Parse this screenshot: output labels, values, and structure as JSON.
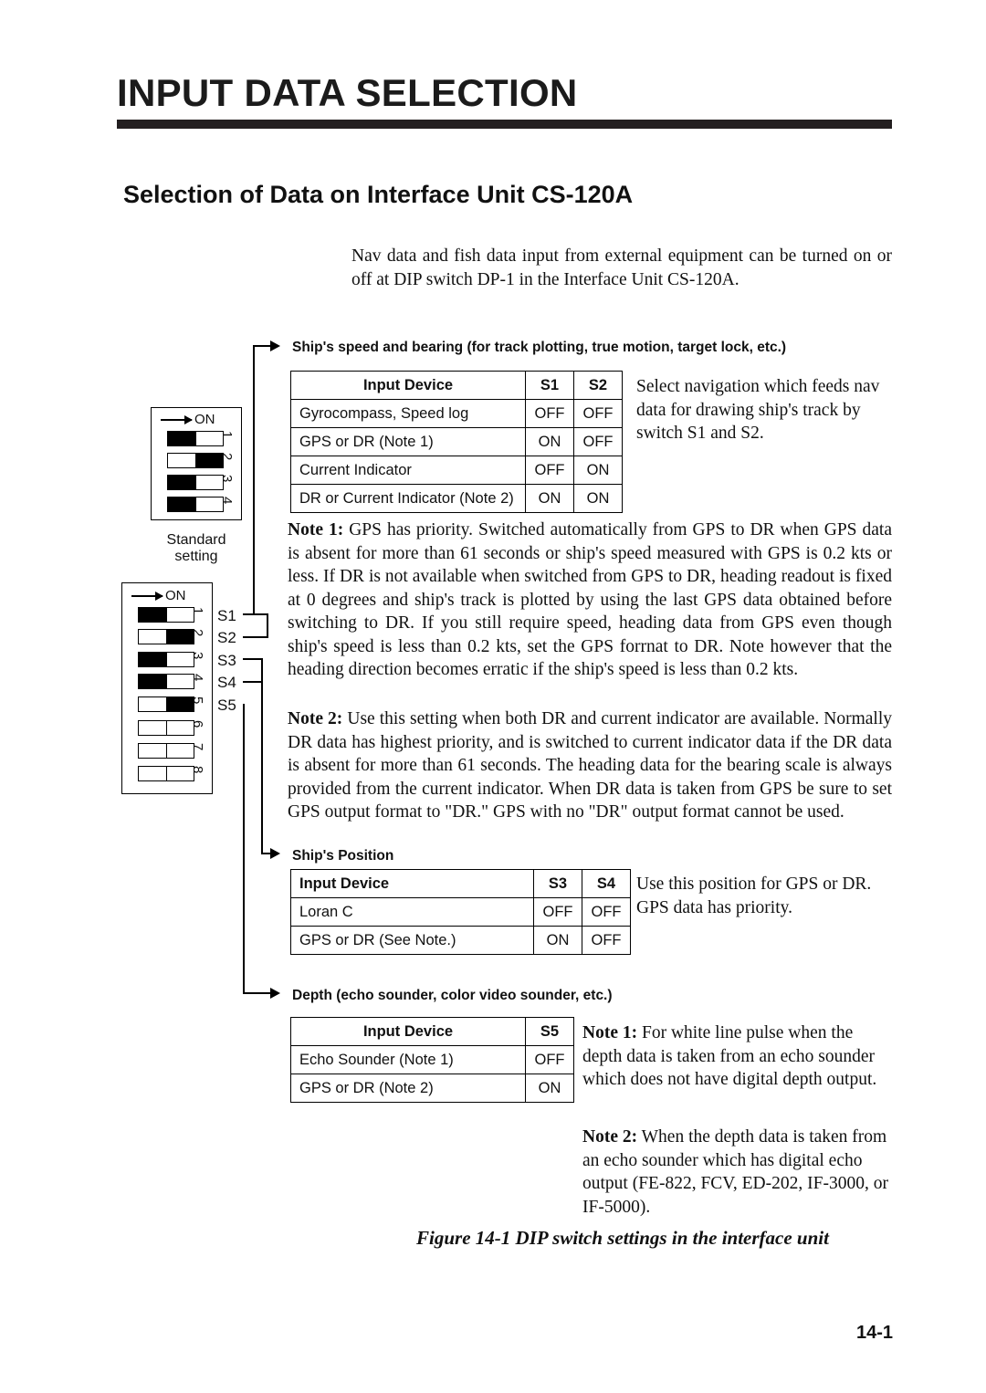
{
  "document": {
    "title": "INPUT DATA SELECTION",
    "section_title": "Selection of Data on Interface Unit CS-120A",
    "intro_paragraph": "Nav data and fish data input from external equipment can be turned on or off at DIP switch DP-1 in the Interface Unit CS-120A.",
    "figure_caption": "Figure 14-1 DIP switch settings in the interface unit",
    "page_number": "14-1"
  },
  "dip_switches": {
    "standard": {
      "on_label": "ON",
      "caption_line1": "Standard",
      "caption_line2": "setting",
      "positions": [
        {
          "number": "1",
          "state": "left"
        },
        {
          "number": "2",
          "state": "right"
        },
        {
          "number": "3",
          "state": "left"
        },
        {
          "number": "4",
          "state": "left"
        }
      ]
    },
    "main": {
      "on_label": "ON",
      "positions": [
        {
          "number": "1",
          "label": "S1",
          "state": "left"
        },
        {
          "number": "2",
          "label": "S2",
          "state": "right"
        },
        {
          "number": "3",
          "label": "S3",
          "state": "left"
        },
        {
          "number": "4",
          "label": "S4",
          "state": "left"
        },
        {
          "number": "5",
          "label": "S5",
          "state": "right"
        },
        {
          "number": "6",
          "label": "",
          "state": "none"
        },
        {
          "number": "7",
          "label": "",
          "state": "none"
        },
        {
          "number": "8",
          "label": "",
          "state": "none"
        }
      ]
    }
  },
  "groups": {
    "speed": {
      "label": "Ship's speed and bearing (for track plotting,  true motion, target lock, etc.)",
      "table": {
        "headers": [
          "Input Device",
          "S1",
          "S2"
        ],
        "rows": [
          {
            "device": "Gyrocompass, Speed log",
            "s1": "OFF",
            "s2": "OFF"
          },
          {
            "device": "GPS or DR (Note 1)",
            "s1": "ON",
            "s2": "OFF"
          },
          {
            "device": "Current Indicator",
            "s1": "OFF",
            "s2": "ON"
          },
          {
            "device": "DR or Current Indicator (Note 2)",
            "s1": "ON",
            "s2": "ON"
          }
        ]
      },
      "side_text": "Select navigation which feeds nav data for drawing ship's track by switch S1 and S2."
    },
    "position": {
      "label": "Ship's Position",
      "table": {
        "headers": [
          "Input Device",
          "S3",
          "S4"
        ],
        "rows": [
          {
            "device": "Loran C",
            "s3": "OFF",
            "s4": "OFF"
          },
          {
            "device": "GPS or DR (See Note.)",
            "s3": "ON",
            "s4": "OFF"
          }
        ]
      },
      "side_text": "Use this position for GPS or DR. GPS data has priority."
    },
    "depth": {
      "label": "Depth (echo sounder, color video sounder, etc.)",
      "table": {
        "headers": [
          "Input Device",
          "S5"
        ],
        "rows": [
          {
            "device": "Echo Sounder (Note 1)",
            "s5": "OFF"
          },
          {
            "device": "GPS or DR (Note 2)",
            "s5": "ON"
          }
        ]
      },
      "side_note1_bold": "Note 1:",
      "side_note1": " For white line pulse when the depth data is taken from an echo sounder which does not have digital depth output.",
      "side_note2_bold": "Note 2:",
      "side_note2": " When the depth data is taken from an echo sounder which has digital echo output (FE-822, FCV, ED-202, IF-3000, or IF-5000)."
    }
  },
  "notes": {
    "note1_bold": "Note 1:",
    "note1_text": " GPS has priority. Switched automatically from GPS to DR when GPS data is absent for more than 61 seconds or ship's speed measured with GPS is 0.2 kts or less. If DR is not available when switched from GPS to DR, heading readout is fixed at 0 degrees and ship's track is plotted by using the last GPS data obtained before switching to DR. If you still require speed, heading data from GPS even though ship's speed is less than 0.2 kts, set the GPS forrnat to DR. Note however that the heading direction becomes erratic if the ship's speed is less than 0.2 kts.",
    "note2_bold": "Note 2:",
    "note2_text": " Use this setting when both DR and current indicator are available. Normally DR data has highest priority, and is switched to current indicator data if the DR data is absent for more than 61 seconds. The heading data for the bearing scale is always provided from the current indicator. When DR data is taken from GPS be sure to set GPS output format to \"DR.\" GPS with no \"DR\" output format cannot be used."
  }
}
